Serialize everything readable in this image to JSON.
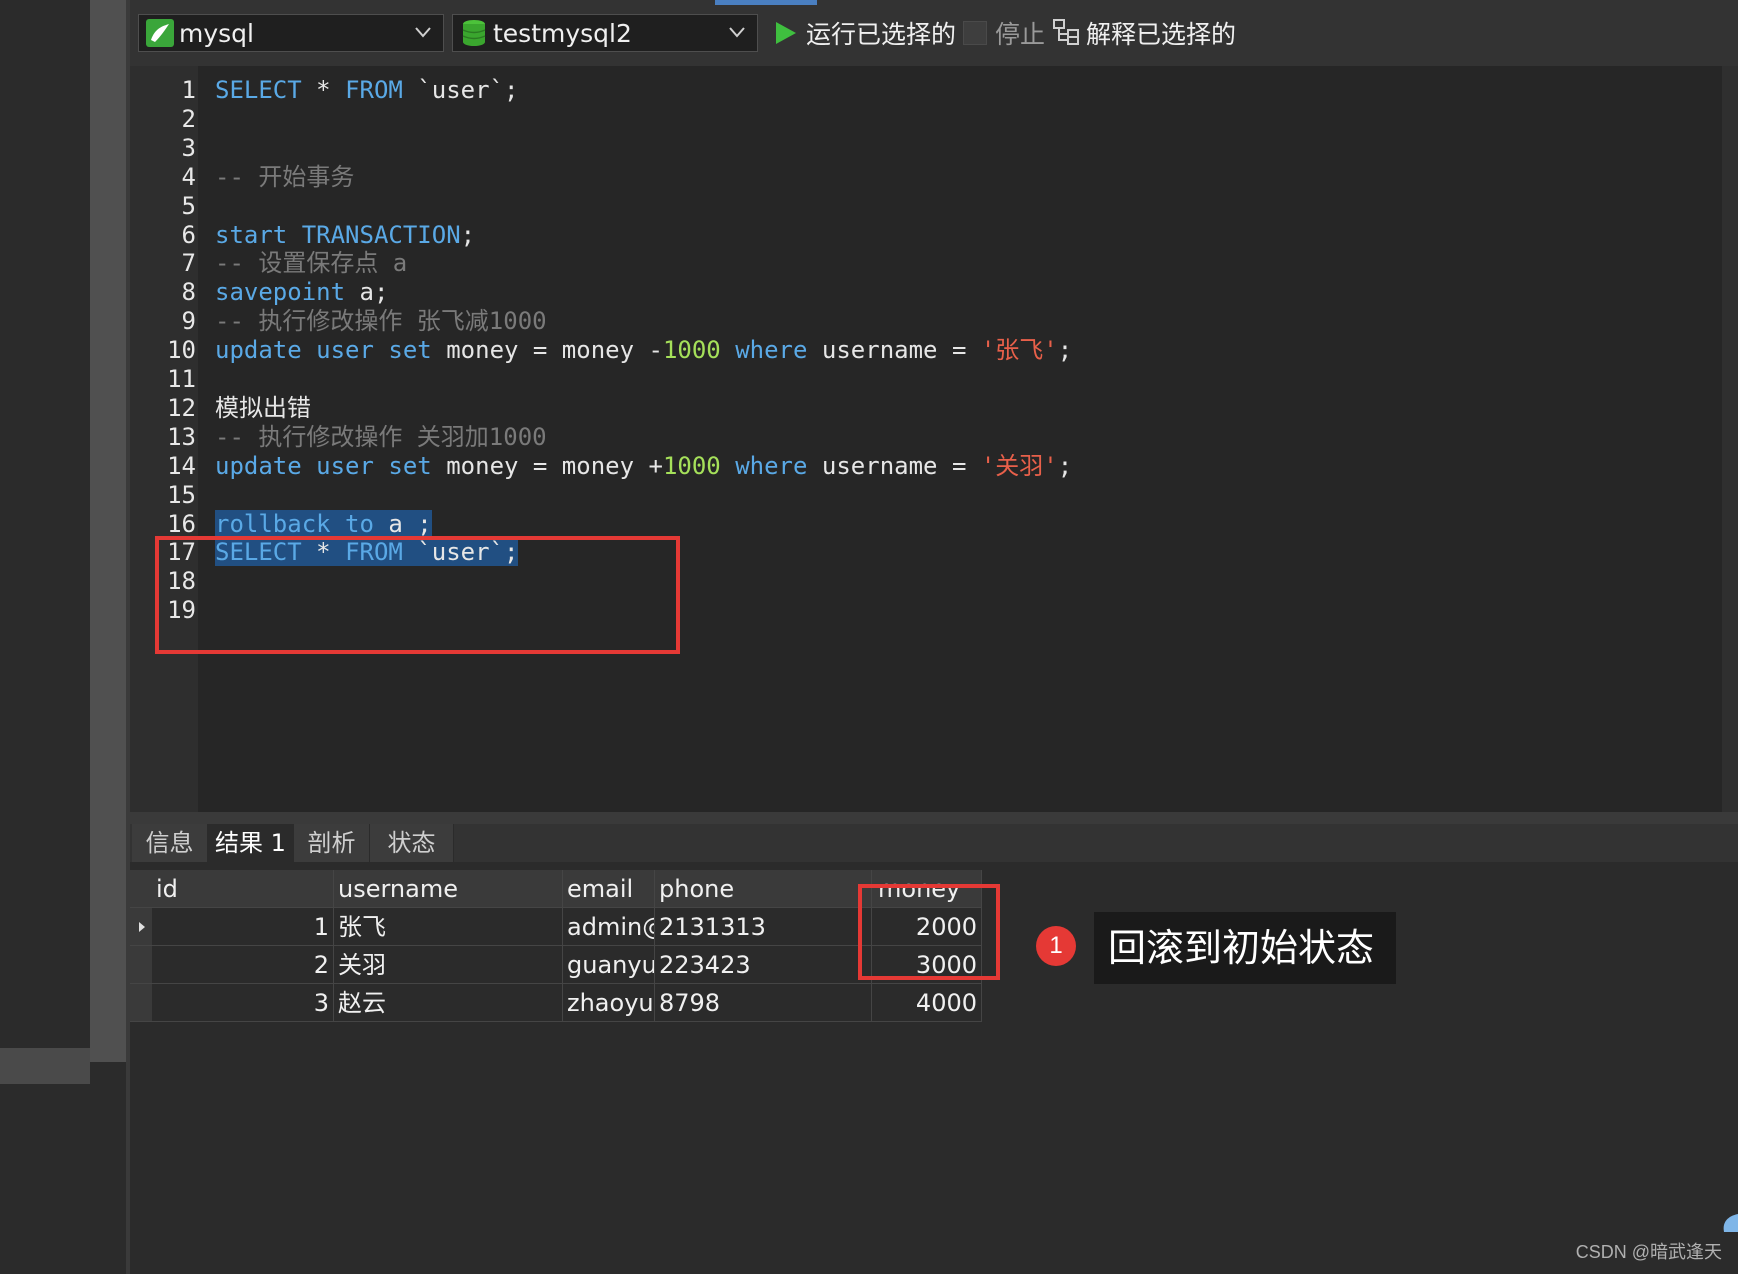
{
  "toolbar": {
    "connection": "mysql",
    "database": "testmysql2",
    "run_label": "运行已选择的",
    "stop_label": "停止",
    "explain_label": "解释已选择的"
  },
  "editor": {
    "line_numbers": [
      "1",
      "2",
      "3",
      "4",
      "5",
      "6",
      "7",
      "8",
      "9",
      "10",
      "11",
      "12",
      "13",
      "14",
      "15",
      "16",
      "17",
      "18",
      "19"
    ],
    "lines": [
      {
        "n": "1",
        "parts": [
          {
            "t": "SELECT",
            "c": "kw"
          },
          {
            "t": " * "
          },
          {
            "t": "FROM",
            "c": "kw"
          },
          {
            "t": " `user`;"
          }
        ]
      },
      {
        "n": "4",
        "parts": [
          {
            "t": "-- 开始事务",
            "c": "cmt"
          }
        ]
      },
      {
        "n": "6",
        "parts": [
          {
            "t": "start",
            "c": "kw"
          },
          {
            "t": " "
          },
          {
            "t": "TRANSACTION",
            "c": "kw"
          },
          {
            "t": ";"
          }
        ]
      },
      {
        "n": "7",
        "parts": [
          {
            "t": "-- 设置保存点 a",
            "c": "cmt"
          }
        ]
      },
      {
        "n": "8",
        "parts": [
          {
            "t": "savepoint",
            "c": "kw"
          },
          {
            "t": " a;"
          }
        ]
      },
      {
        "n": "9",
        "parts": [
          {
            "t": "-- 执行修改操作 张飞减1000",
            "c": "cmt"
          }
        ]
      },
      {
        "n": "10",
        "parts": [
          {
            "t": "update",
            "c": "kw"
          },
          {
            "t": " "
          },
          {
            "t": "user",
            "c": "kw"
          },
          {
            "t": " "
          },
          {
            "t": "set",
            "c": "kw"
          },
          {
            "t": " money = money -"
          },
          {
            "t": "1000",
            "c": "num"
          },
          {
            "t": " "
          },
          {
            "t": "where",
            "c": "kw"
          },
          {
            "t": " username = "
          },
          {
            "t": "'张飞'",
            "c": "str"
          },
          {
            "t": ";"
          }
        ]
      },
      {
        "n": "12",
        "parts": [
          {
            "t": "模拟出错"
          }
        ]
      },
      {
        "n": "13",
        "parts": [
          {
            "t": "-- 执行修改操作 关羽加1000",
            "c": "cmt"
          }
        ]
      },
      {
        "n": "14",
        "parts": [
          {
            "t": "update",
            "c": "kw"
          },
          {
            "t": " "
          },
          {
            "t": "user",
            "c": "kw"
          },
          {
            "t": " "
          },
          {
            "t": "set",
            "c": "kw"
          },
          {
            "t": " money = money +"
          },
          {
            "t": "1000",
            "c": "num"
          },
          {
            "t": " "
          },
          {
            "t": "where",
            "c": "kw"
          },
          {
            "t": " username = "
          },
          {
            "t": "'关羽'",
            "c": "str"
          },
          {
            "t": ";"
          }
        ]
      },
      {
        "n": "16",
        "selected": true,
        "parts": [
          {
            "t": "rollback",
            "c": "kw"
          },
          {
            "t": " "
          },
          {
            "t": "to",
            "c": "kw"
          },
          {
            "t": " a ;"
          }
        ]
      },
      {
        "n": "17",
        "selected": true,
        "parts": [
          {
            "t": "SELECT",
            "c": "kw"
          },
          {
            "t": " * "
          },
          {
            "t": "FROM",
            "c": "kw"
          },
          {
            "t": " `user`;"
          }
        ]
      }
    ]
  },
  "tabs": [
    "信息",
    "结果 1",
    "剖析",
    "状态"
  ],
  "active_tab": "结果 1",
  "results": {
    "columns": [
      "id",
      "username",
      "email",
      "phone",
      "money"
    ],
    "rows": [
      [
        "1",
        "张飞",
        "admin@",
        "2131313",
        "2000"
      ],
      [
        "2",
        "关羽",
        "guanyu",
        "223423",
        "3000"
      ],
      [
        "3",
        "赵云",
        "zhaoyun",
        "8798",
        "4000"
      ]
    ]
  },
  "annotation": {
    "number": "1",
    "text": "回滚到初始状态"
  },
  "watermark": "CSDN @暗武逢天",
  "colors": {
    "keyword": "#5aa9e6",
    "number": "#a5e05a",
    "string": "#e8604a",
    "comment": "#7a7a7a",
    "highlight": "#e53935"
  }
}
